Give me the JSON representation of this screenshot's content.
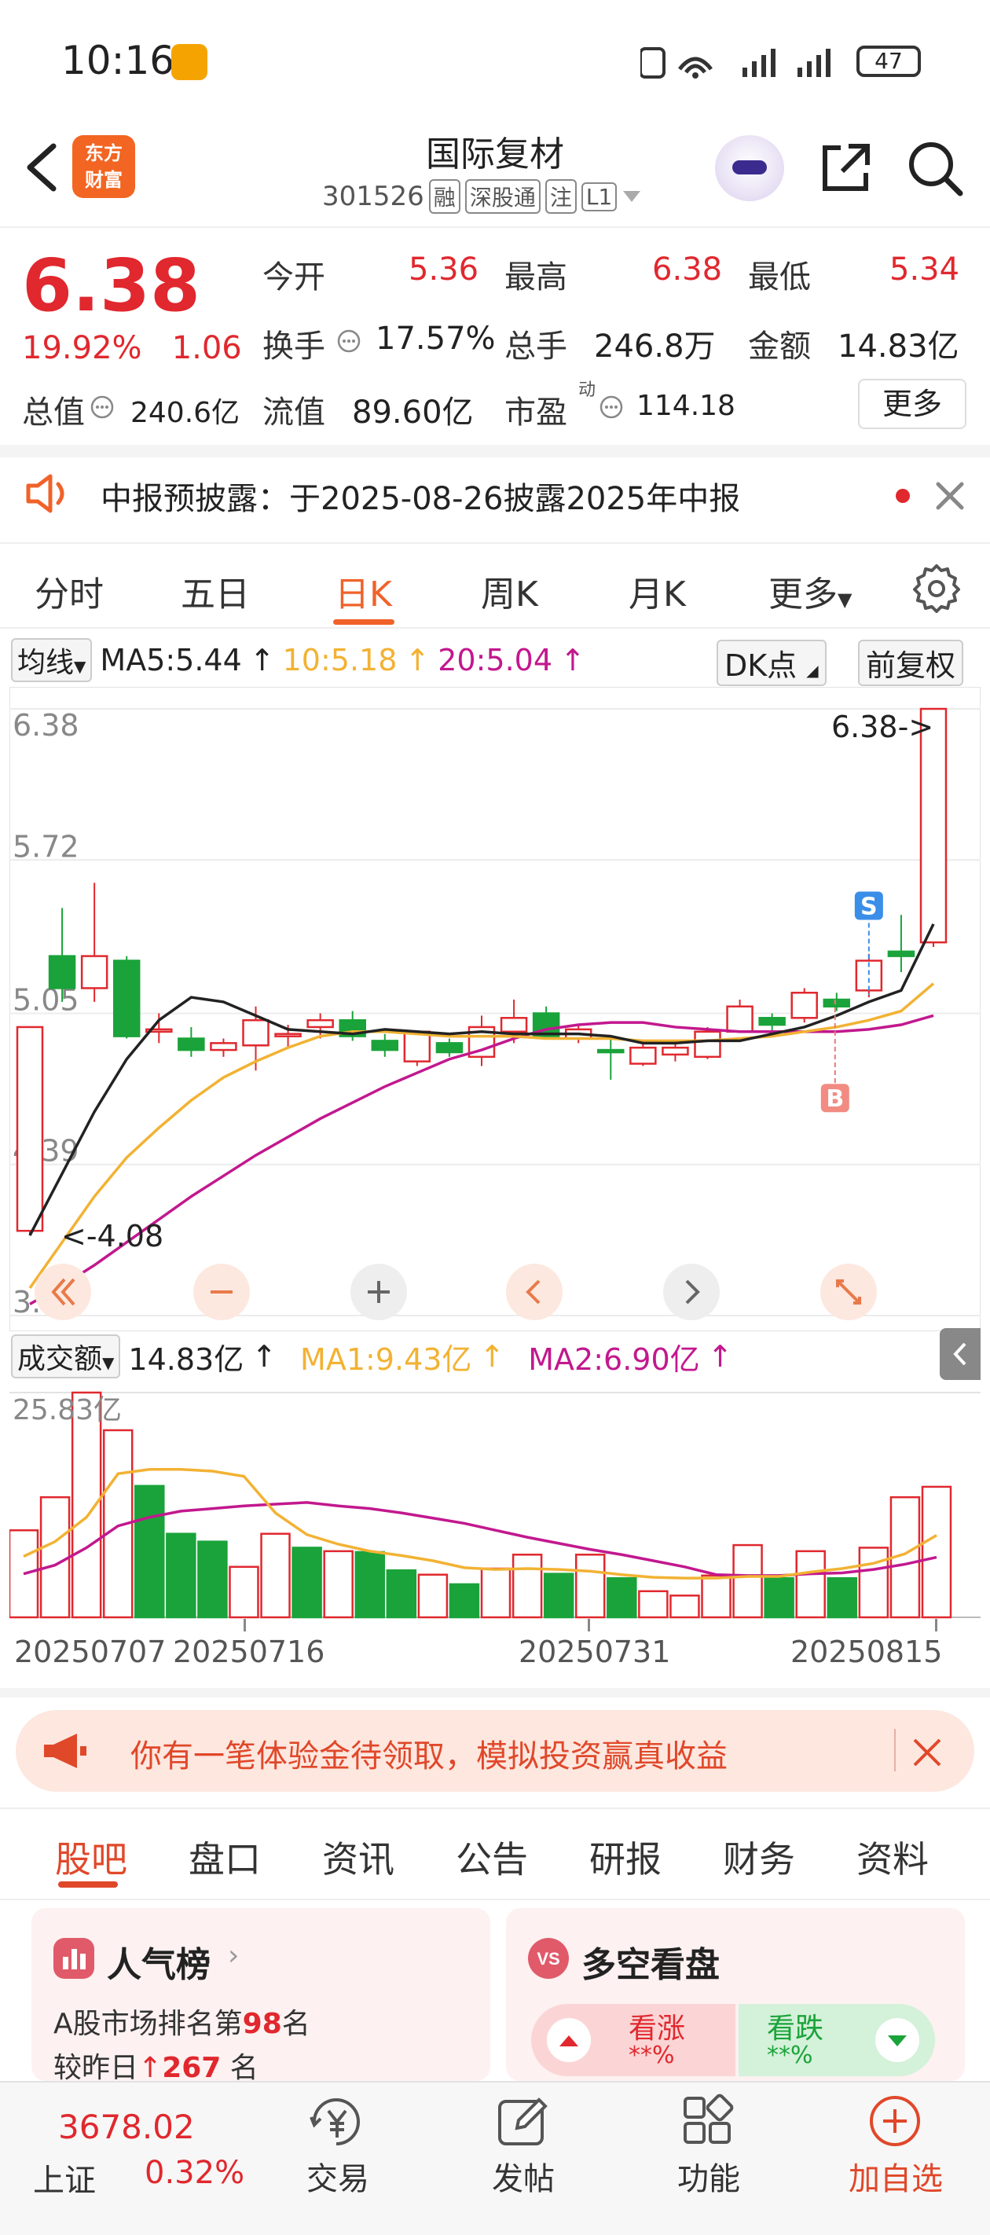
{
  "status_bar": {
    "time": "10:16",
    "battery": "47"
  },
  "header": {
    "stock_name": "国际复材",
    "stock_code": "301526",
    "tags": [
      "融",
      "深股通",
      "注",
      "L1"
    ],
    "logo_text_line1": "东方",
    "logo_text_line2": "财富"
  },
  "quote": {
    "price": "6.38",
    "change_pct": "19.92%",
    "change_amt": "1.06",
    "fields": [
      {
        "label": "今开",
        "value": "5.36",
        "color": "red"
      },
      {
        "label": "最高",
        "value": "6.38",
        "color": "red"
      },
      {
        "label": "最低",
        "value": "5.34",
        "color": "red"
      },
      {
        "label": "换手",
        "value": "17.57%",
        "color": "normal"
      },
      {
        "label": "总手",
        "value": "246.8万",
        "color": "normal"
      },
      {
        "label": "金额",
        "value": "14.83亿",
        "color": "normal"
      },
      {
        "label": "总值",
        "value": "240.6亿",
        "color": "normal"
      },
      {
        "label": "流值",
        "value": "89.60亿",
        "color": "normal"
      },
      {
        "label": "市盈",
        "value": "114.18",
        "color": "normal",
        "superscript": "动"
      }
    ],
    "more_label": "更多"
  },
  "notice": {
    "text": "中报预披露：于2025-08-26披露2025年中报"
  },
  "chart_tabs": [
    "分时",
    "五日",
    "日K",
    "周K",
    "月K",
    "更多"
  ],
  "active_chart_tab": "日K",
  "indicators": {
    "ma_selector": "均线",
    "ma5": "MA5:5.44",
    "ma10": "10:5.18",
    "ma20": "20:5.04",
    "dk_label": "DK点",
    "adjust_label": "前复权",
    "colors": {
      "ma5": "#222222",
      "ma10": "#f2b233",
      "ma20": "#c2188e"
    }
  },
  "chart_data": {
    "type": "candlestick",
    "y_labels": [
      "6.38",
      "5.72",
      "5.05",
      "4.39",
      "3.73"
    ],
    "ylim": [
      3.73,
      6.38
    ],
    "x_labels": [
      "20250707",
      "20250716",
      "20250731",
      "20250815"
    ],
    "annotations": {
      "high": "6.38->",
      "low": "<-4.08",
      "sell_marker": "S",
      "buy_marker": "B"
    },
    "candles": [
      {
        "o": 4.1,
        "c": 4.99,
        "h": 4.99,
        "l": 4.08
      },
      {
        "o": 5.3,
        "c": 5.16,
        "h": 5.51,
        "l": 5.1
      },
      {
        "o": 5.16,
        "c": 5.3,
        "h": 5.62,
        "l": 5.1
      },
      {
        "o": 5.28,
        "c": 4.95,
        "h": 5.3,
        "l": 4.94
      },
      {
        "o": 4.98,
        "c": 4.98,
        "h": 5.05,
        "l": 4.92
      },
      {
        "o": 4.94,
        "c": 4.89,
        "h": 4.99,
        "l": 4.86
      },
      {
        "o": 4.89,
        "c": 4.92,
        "h": 4.94,
        "l": 4.86
      },
      {
        "o": 4.91,
        "c": 5.02,
        "h": 5.08,
        "l": 4.8
      },
      {
        "o": 4.95,
        "c": 4.96,
        "h": 5.0,
        "l": 4.9
      },
      {
        "o": 4.99,
        "c": 5.02,
        "h": 5.05,
        "l": 4.94
      },
      {
        "o": 5.02,
        "c": 4.95,
        "h": 5.06,
        "l": 4.93
      },
      {
        "o": 4.93,
        "c": 4.89,
        "h": 4.96,
        "l": 4.86
      },
      {
        "o": 4.84,
        "c": 4.97,
        "h": 4.97,
        "l": 4.82
      },
      {
        "o": 4.92,
        "c": 4.88,
        "h": 4.94,
        "l": 4.86
      },
      {
        "o": 4.86,
        "c": 4.99,
        "h": 5.04,
        "l": 4.82
      },
      {
        "o": 4.97,
        "c": 5.03,
        "h": 5.11,
        "l": 4.92
      },
      {
        "o": 5.05,
        "c": 4.95,
        "h": 5.08,
        "l": 4.94
      },
      {
        "o": 4.94,
        "c": 4.98,
        "h": 5.0,
        "l": 4.92
      },
      {
        "o": 4.89,
        "c": 4.88,
        "h": 4.94,
        "l": 4.76
      },
      {
        "o": 4.83,
        "c": 4.9,
        "h": 4.92,
        "l": 4.82
      },
      {
        "o": 4.87,
        "c": 4.9,
        "h": 4.93,
        "l": 4.84
      },
      {
        "o": 4.86,
        "c": 4.97,
        "h": 4.99,
        "l": 4.85
      },
      {
        "o": 4.97,
        "c": 5.08,
        "h": 5.11,
        "l": 4.97
      },
      {
        "o": 5.03,
        "c": 5.0,
        "h": 5.05,
        "l": 4.97
      },
      {
        "o": 5.03,
        "c": 5.14,
        "h": 5.16,
        "l": 5.01
      },
      {
        "o": 5.11,
        "c": 5.08,
        "h": 5.14,
        "l": 5.06
      },
      {
        "o": 5.15,
        "c": 5.28,
        "h": 5.31,
        "l": 5.12
      },
      {
        "o": 5.32,
        "c": 5.3,
        "h": 5.48,
        "l": 5.23
      },
      {
        "o": 5.36,
        "c": 6.38,
        "h": 6.38,
        "l": 5.34
      }
    ],
    "ma5": [
      4.08,
      4.35,
      4.62,
      4.85,
      5.02,
      5.12,
      5.1,
      5.04,
      4.98,
      4.97,
      4.96,
      4.98,
      4.97,
      4.96,
      4.97,
      4.96,
      4.96,
      4.96,
      4.95,
      4.92,
      4.92,
      4.93,
      4.93,
      4.96,
      4.99,
      5.04,
      5.1,
      5.15,
      5.44
    ],
    "ma10": [
      3.85,
      4.05,
      4.25,
      4.42,
      4.55,
      4.67,
      4.77,
      4.84,
      4.9,
      4.95,
      4.97,
      4.97,
      4.96,
      4.95,
      4.95,
      4.95,
      4.94,
      4.94,
      4.94,
      4.93,
      4.93,
      4.93,
      4.94,
      4.95,
      4.97,
      4.99,
      5.02,
      5.06,
      5.18
    ],
    "ma20": [
      3.78,
      3.86,
      3.95,
      4.05,
      4.15,
      4.25,
      4.34,
      4.43,
      4.51,
      4.59,
      4.66,
      4.73,
      4.79,
      4.85,
      4.89,
      4.94,
      4.98,
      5.0,
      5.01,
      5.01,
      4.99,
      4.98,
      4.97,
      4.97,
      4.97,
      4.97,
      4.98,
      5.0,
      5.04
    ]
  },
  "volume": {
    "selector": "成交额",
    "value": "14.83亿",
    "ma1": "MA1:9.43亿",
    "ma2": "MA2:6.90亿",
    "top_label": "25.83亿",
    "max": 25.83,
    "bars": [
      {
        "v": 10.0,
        "up": true
      },
      {
        "v": 13.8,
        "up": true
      },
      {
        "v": 25.83,
        "up": true
      },
      {
        "v": 21.5,
        "up": true
      },
      {
        "v": 15.1,
        "up": false
      },
      {
        "v": 9.6,
        "up": false
      },
      {
        "v": 8.7,
        "up": false
      },
      {
        "v": 5.8,
        "up": true
      },
      {
        "v": 9.6,
        "up": true
      },
      {
        "v": 8.0,
        "up": false
      },
      {
        "v": 7.6,
        "up": true
      },
      {
        "v": 7.5,
        "up": false
      },
      {
        "v": 5.4,
        "up": false
      },
      {
        "v": 4.9,
        "up": true
      },
      {
        "v": 3.8,
        "up": false
      },
      {
        "v": 5.6,
        "up": true
      },
      {
        "v": 7.2,
        "up": true
      },
      {
        "v": 5.0,
        "up": false
      },
      {
        "v": 7.2,
        "up": true
      },
      {
        "v": 4.5,
        "up": false
      },
      {
        "v": 3.0,
        "up": true
      },
      {
        "v": 2.5,
        "up": true
      },
      {
        "v": 4.8,
        "up": true
      },
      {
        "v": 8.3,
        "up": true
      },
      {
        "v": 4.5,
        "up": false
      },
      {
        "v": 7.6,
        "up": true
      },
      {
        "v": 4.5,
        "up": false
      },
      {
        "v": 8.0,
        "up": true
      },
      {
        "v": 13.8,
        "up": true
      },
      {
        "v": 15.0,
        "up": true
      }
    ],
    "ma1_line": [
      7.0,
      8.7,
      11.5,
      16.5,
      17.0,
      17.0,
      16.8,
      16.2,
      12.0,
      9.5,
      8.4,
      7.6,
      7.1,
      6.5,
      5.7,
      5.5,
      5.6,
      5.5,
      5.3,
      4.9,
      4.6,
      4.5,
      4.5,
      4.7,
      4.7,
      5.2,
      5.6,
      6.2,
      7.3,
      9.43
    ],
    "ma2_line": [
      5.0,
      6.0,
      8.0,
      10.5,
      11.5,
      12.2,
      12.5,
      12.8,
      13.0,
      13.2,
      12.8,
      12.5,
      12.0,
      11.4,
      10.8,
      10.0,
      9.2,
      8.5,
      7.8,
      7.2,
      6.5,
      5.8,
      4.9,
      4.8,
      4.8,
      5.0,
      5.1,
      5.5,
      6.1,
      6.9
    ]
  },
  "banner": {
    "text": "你有一笔体验金待领取，模拟投资赢真收益"
  },
  "section_tabs": [
    "股吧",
    "盘口",
    "资讯",
    "公告",
    "研报",
    "财务",
    "资料"
  ],
  "active_section_tab": "股吧",
  "popularity_card": {
    "title": "人气榜",
    "line1_prefix": "A股市场排名第",
    "rank": "98",
    "line1_suffix": "名",
    "line2_prefix": "较昨日",
    "delta": "267",
    "line2_suffix": "名"
  },
  "sentiment_card": {
    "title": "多空看盘",
    "bull_label": "看涨",
    "bull_value": "**%",
    "bear_label": "看跌",
    "bear_value": "**%"
  },
  "bottom_nav": {
    "index_value": "3678.02",
    "index_name": "上证",
    "index_change": "0.32%",
    "items": [
      "交易",
      "发帖",
      "功能",
      "加自选"
    ]
  }
}
